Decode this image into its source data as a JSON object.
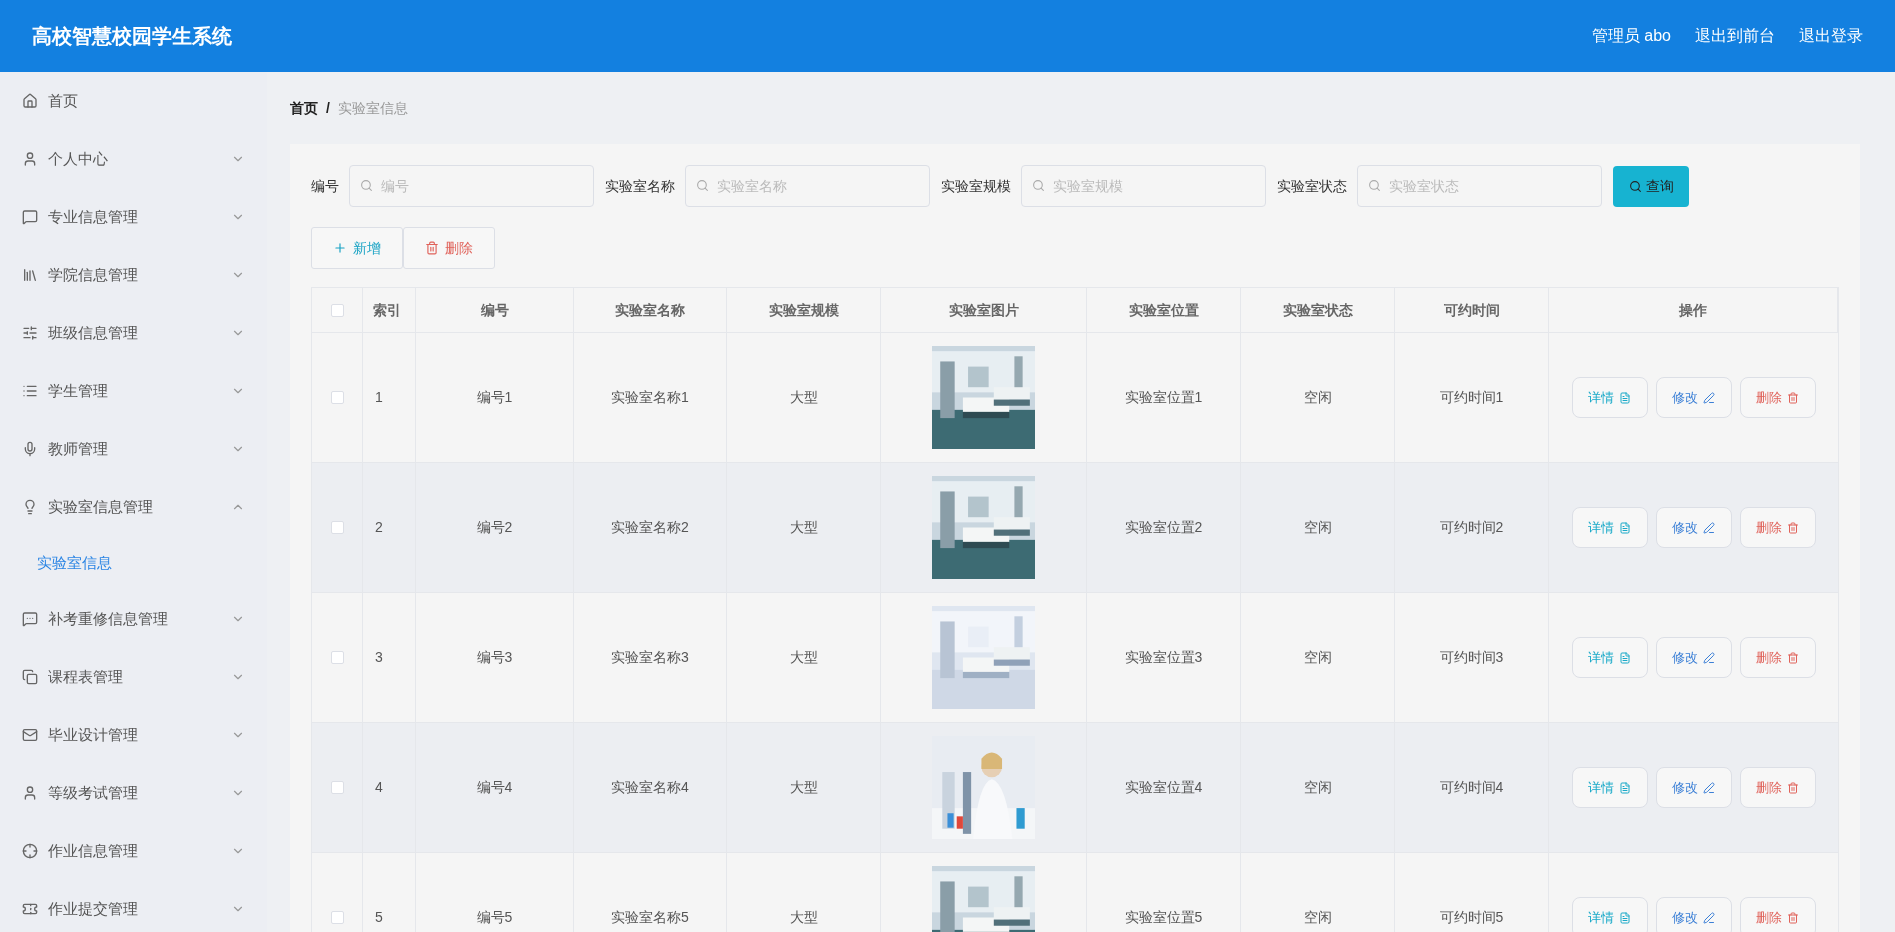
{
  "header": {
    "title": "高校智慧校园学生系统",
    "links": [
      "管理员 abo",
      "退出到前台",
      "退出登录"
    ]
  },
  "sidebar": {
    "items": [
      {
        "label": "首页",
        "kind": "link"
      },
      {
        "label": "个人中心",
        "kind": "menu",
        "expanded": false
      },
      {
        "label": "专业信息管理",
        "kind": "menu",
        "expanded": false
      },
      {
        "label": "学院信息管理",
        "kind": "menu",
        "expanded": false
      },
      {
        "label": "班级信息管理",
        "kind": "menu",
        "expanded": false
      },
      {
        "label": "学生管理",
        "kind": "menu",
        "expanded": false
      },
      {
        "label": "教师管理",
        "kind": "menu",
        "expanded": false
      },
      {
        "label": "实验室信息管理",
        "kind": "menu",
        "expanded": true,
        "children": [
          {
            "label": "实验室信息",
            "selected": true
          }
        ]
      },
      {
        "label": "补考重修信息管理",
        "kind": "menu",
        "expanded": false
      },
      {
        "label": "课程表管理",
        "kind": "menu",
        "expanded": false
      },
      {
        "label": "毕业设计管理",
        "kind": "menu",
        "expanded": false
      },
      {
        "label": "等级考试管理",
        "kind": "menu",
        "expanded": false
      },
      {
        "label": "作业信息管理",
        "kind": "menu",
        "expanded": false
      },
      {
        "label": "作业提交管理",
        "kind": "menu",
        "expanded": false
      }
    ]
  },
  "breadcrumb": [
    "首页",
    "/",
    "实验室信息"
  ],
  "search": {
    "fields": [
      {
        "label": "编号",
        "placeholder": "编号"
      },
      {
        "label": "实验室名称",
        "placeholder": "实验室名称"
      },
      {
        "label": "实验室规模",
        "placeholder": "实验室规模"
      },
      {
        "label": "实验室状态",
        "placeholder": "实验室状态"
      }
    ],
    "button": "查询"
  },
  "toolbar": [
    {
      "label": "新增",
      "kind": "add"
    },
    {
      "label": "删除",
      "kind": "delete"
    }
  ],
  "table": {
    "header_checked": false,
    "columns": [
      "索引",
      "编号",
      "实验室名称",
      "实验室规模",
      "实验室图片",
      "实验室位置",
      "实验室状态",
      "可约时间",
      "操作"
    ],
    "rows": [
      {
        "checked": false,
        "cells": [
          "1",
          "编号1",
          "实验室名称1",
          "大型"
        ],
        "image": {
          "kind": "picture"
        },
        "cells_after": [
          "实验室位置1",
          "空闲",
          "可约时间1"
        ],
        "actions": [
          {
            "label": "详情",
            "kind": "detail"
          },
          {
            "label": "修改",
            "kind": "edit"
          },
          {
            "label": "删除",
            "kind": "delete"
          }
        ]
      },
      {
        "checked": false,
        "cells": [
          "2",
          "编号2",
          "实验室名称2",
          "大型"
        ],
        "image": {
          "kind": "picture"
        },
        "cells_after": [
          "实验室位置2",
          "空闲",
          "可约时间2"
        ],
        "actions": [
          {
            "label": "详情",
            "kind": "detail"
          },
          {
            "label": "修改",
            "kind": "edit"
          },
          {
            "label": "删除",
            "kind": "delete"
          }
        ]
      },
      {
        "checked": false,
        "cells": [
          "3",
          "编号3",
          "实验室名称3",
          "大型"
        ],
        "image": {
          "kind": "picture"
        },
        "cells_after": [
          "实验室位置3",
          "空闲",
          "可约时间3"
        ],
        "actions": [
          {
            "label": "详情",
            "kind": "detail"
          },
          {
            "label": "修改",
            "kind": "edit"
          },
          {
            "label": "删除",
            "kind": "delete"
          }
        ]
      },
      {
        "checked": false,
        "cells": [
          "4",
          "编号4",
          "实验室名称4",
          "大型"
        ],
        "image": {
          "kind": "picture"
        },
        "cells_after": [
          "实验室位置4",
          "空闲",
          "可约时间4"
        ],
        "actions": [
          {
            "label": "详情",
            "kind": "detail"
          },
          {
            "label": "修改",
            "kind": "edit"
          },
          {
            "label": "删除",
            "kind": "delete"
          }
        ]
      },
      {
        "checked": false,
        "cells": [
          "5",
          "编号5",
          "实验室名称5",
          "大型"
        ],
        "image": {
          "kind": "picture"
        },
        "cells_after": [
          "实验室位置5",
          "空闲",
          "可约时间5"
        ],
        "actions": [
          {
            "label": "详情",
            "kind": "detail"
          },
          {
            "label": "修改",
            "kind": "edit"
          },
          {
            "label": "删除",
            "kind": "delete"
          }
        ]
      }
    ]
  }
}
